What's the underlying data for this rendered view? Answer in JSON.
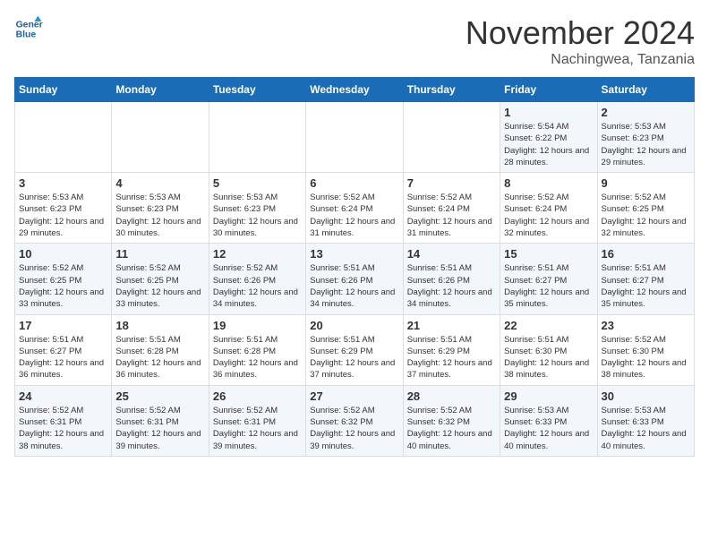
{
  "header": {
    "logo_line1": "General",
    "logo_line2": "Blue",
    "month": "November 2024",
    "location": "Nachingwea, Tanzania"
  },
  "weekdays": [
    "Sunday",
    "Monday",
    "Tuesday",
    "Wednesday",
    "Thursday",
    "Friday",
    "Saturday"
  ],
  "weeks": [
    [
      {
        "day": "",
        "sunrise": "",
        "sunset": "",
        "daylight": ""
      },
      {
        "day": "",
        "sunrise": "",
        "sunset": "",
        "daylight": ""
      },
      {
        "day": "",
        "sunrise": "",
        "sunset": "",
        "daylight": ""
      },
      {
        "day": "",
        "sunrise": "",
        "sunset": "",
        "daylight": ""
      },
      {
        "day": "",
        "sunrise": "",
        "sunset": "",
        "daylight": ""
      },
      {
        "day": "1",
        "sunrise": "Sunrise: 5:54 AM",
        "sunset": "Sunset: 6:22 PM",
        "daylight": "Daylight: 12 hours and 28 minutes."
      },
      {
        "day": "2",
        "sunrise": "Sunrise: 5:53 AM",
        "sunset": "Sunset: 6:23 PM",
        "daylight": "Daylight: 12 hours and 29 minutes."
      }
    ],
    [
      {
        "day": "3",
        "sunrise": "Sunrise: 5:53 AM",
        "sunset": "Sunset: 6:23 PM",
        "daylight": "Daylight: 12 hours and 29 minutes."
      },
      {
        "day": "4",
        "sunrise": "Sunrise: 5:53 AM",
        "sunset": "Sunset: 6:23 PM",
        "daylight": "Daylight: 12 hours and 30 minutes."
      },
      {
        "day": "5",
        "sunrise": "Sunrise: 5:53 AM",
        "sunset": "Sunset: 6:23 PM",
        "daylight": "Daylight: 12 hours and 30 minutes."
      },
      {
        "day": "6",
        "sunrise": "Sunrise: 5:52 AM",
        "sunset": "Sunset: 6:24 PM",
        "daylight": "Daylight: 12 hours and 31 minutes."
      },
      {
        "day": "7",
        "sunrise": "Sunrise: 5:52 AM",
        "sunset": "Sunset: 6:24 PM",
        "daylight": "Daylight: 12 hours and 31 minutes."
      },
      {
        "day": "8",
        "sunrise": "Sunrise: 5:52 AM",
        "sunset": "Sunset: 6:24 PM",
        "daylight": "Daylight: 12 hours and 32 minutes."
      },
      {
        "day": "9",
        "sunrise": "Sunrise: 5:52 AM",
        "sunset": "Sunset: 6:25 PM",
        "daylight": "Daylight: 12 hours and 32 minutes."
      }
    ],
    [
      {
        "day": "10",
        "sunrise": "Sunrise: 5:52 AM",
        "sunset": "Sunset: 6:25 PM",
        "daylight": "Daylight: 12 hours and 33 minutes."
      },
      {
        "day": "11",
        "sunrise": "Sunrise: 5:52 AM",
        "sunset": "Sunset: 6:25 PM",
        "daylight": "Daylight: 12 hours and 33 minutes."
      },
      {
        "day": "12",
        "sunrise": "Sunrise: 5:52 AM",
        "sunset": "Sunset: 6:26 PM",
        "daylight": "Daylight: 12 hours and 34 minutes."
      },
      {
        "day": "13",
        "sunrise": "Sunrise: 5:51 AM",
        "sunset": "Sunset: 6:26 PM",
        "daylight": "Daylight: 12 hours and 34 minutes."
      },
      {
        "day": "14",
        "sunrise": "Sunrise: 5:51 AM",
        "sunset": "Sunset: 6:26 PM",
        "daylight": "Daylight: 12 hours and 34 minutes."
      },
      {
        "day": "15",
        "sunrise": "Sunrise: 5:51 AM",
        "sunset": "Sunset: 6:27 PM",
        "daylight": "Daylight: 12 hours and 35 minutes."
      },
      {
        "day": "16",
        "sunrise": "Sunrise: 5:51 AM",
        "sunset": "Sunset: 6:27 PM",
        "daylight": "Daylight: 12 hours and 35 minutes."
      }
    ],
    [
      {
        "day": "17",
        "sunrise": "Sunrise: 5:51 AM",
        "sunset": "Sunset: 6:27 PM",
        "daylight": "Daylight: 12 hours and 36 minutes."
      },
      {
        "day": "18",
        "sunrise": "Sunrise: 5:51 AM",
        "sunset": "Sunset: 6:28 PM",
        "daylight": "Daylight: 12 hours and 36 minutes."
      },
      {
        "day": "19",
        "sunrise": "Sunrise: 5:51 AM",
        "sunset": "Sunset: 6:28 PM",
        "daylight": "Daylight: 12 hours and 36 minutes."
      },
      {
        "day": "20",
        "sunrise": "Sunrise: 5:51 AM",
        "sunset": "Sunset: 6:29 PM",
        "daylight": "Daylight: 12 hours and 37 minutes."
      },
      {
        "day": "21",
        "sunrise": "Sunrise: 5:51 AM",
        "sunset": "Sunset: 6:29 PM",
        "daylight": "Daylight: 12 hours and 37 minutes."
      },
      {
        "day": "22",
        "sunrise": "Sunrise: 5:51 AM",
        "sunset": "Sunset: 6:30 PM",
        "daylight": "Daylight: 12 hours and 38 minutes."
      },
      {
        "day": "23",
        "sunrise": "Sunrise: 5:52 AM",
        "sunset": "Sunset: 6:30 PM",
        "daylight": "Daylight: 12 hours and 38 minutes."
      }
    ],
    [
      {
        "day": "24",
        "sunrise": "Sunrise: 5:52 AM",
        "sunset": "Sunset: 6:31 PM",
        "daylight": "Daylight: 12 hours and 38 minutes."
      },
      {
        "day": "25",
        "sunrise": "Sunrise: 5:52 AM",
        "sunset": "Sunset: 6:31 PM",
        "daylight": "Daylight: 12 hours and 39 minutes."
      },
      {
        "day": "26",
        "sunrise": "Sunrise: 5:52 AM",
        "sunset": "Sunset: 6:31 PM",
        "daylight": "Daylight: 12 hours and 39 minutes."
      },
      {
        "day": "27",
        "sunrise": "Sunrise: 5:52 AM",
        "sunset": "Sunset: 6:32 PM",
        "daylight": "Daylight: 12 hours and 39 minutes."
      },
      {
        "day": "28",
        "sunrise": "Sunrise: 5:52 AM",
        "sunset": "Sunset: 6:32 PM",
        "daylight": "Daylight: 12 hours and 40 minutes."
      },
      {
        "day": "29",
        "sunrise": "Sunrise: 5:53 AM",
        "sunset": "Sunset: 6:33 PM",
        "daylight": "Daylight: 12 hours and 40 minutes."
      },
      {
        "day": "30",
        "sunrise": "Sunrise: 5:53 AM",
        "sunset": "Sunset: 6:33 PM",
        "daylight": "Daylight: 12 hours and 40 minutes."
      }
    ]
  ]
}
